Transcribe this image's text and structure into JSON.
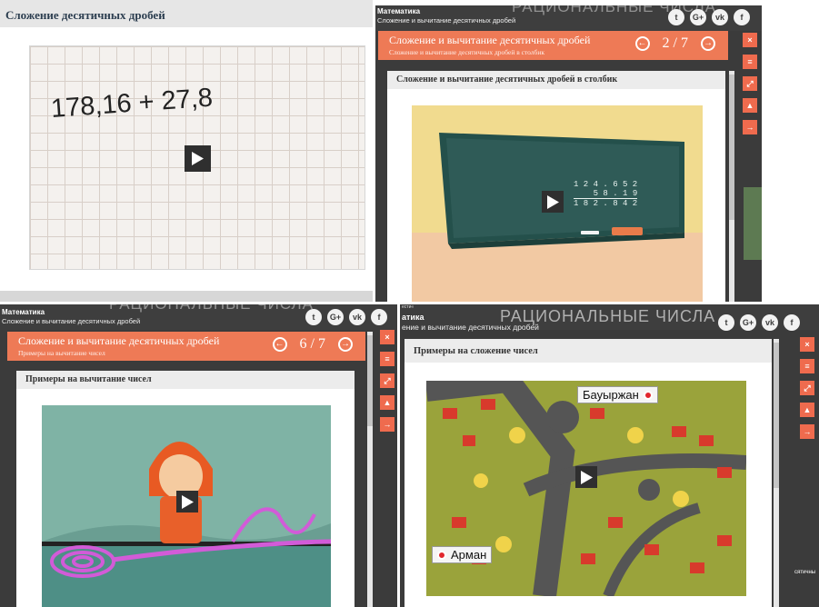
{
  "panel1": {
    "header": "Сложение десятичных дробей",
    "formula": "178,16 + 27,8"
  },
  "panel2": {
    "ghost_title": "РАЦИОНАЛЬНЫЕ ЧИСЛА",
    "subject": "Математика",
    "lesson": "Сложение и вычитание десятичных дробей",
    "orange_title": "Сложение и вычитание десятичных дробей",
    "orange_sub": "Сложение и вычитание десятичных дробей в столбик",
    "page": "2 / 7",
    "card_title": "Сложение и вычитание десятичных дробей в столбик",
    "board_row1": "1 2 4 . 6 5 2",
    "board_row2": "5 8 . 1 9",
    "board_row3": "1 8 2 . 8 4 2"
  },
  "panel3": {
    "ghost_title": "РАЦИОНАЛЬНЫЕ ЧИСЛА",
    "subject": "Математика",
    "lesson": "Сложение и вычитание десятичных дробей",
    "orange_title": "Сложение и вычитание десятичных дробей",
    "orange_sub": "Примеры на вычитание чисел",
    "page": "6 / 7",
    "card_title": "Примеры на вычитание чисел"
  },
  "panel4": {
    "ghost_title": "РАЦИОНАЛЬНЫЕ ЧИСЛА",
    "subject": "атика",
    "lesson": "ение и вычитание десятичных дробей",
    "tiny_label": "ести«",
    "card_title": "Примеры на сложение чисел",
    "label_a": "Бауыржан",
    "label_b": "Арман",
    "side_text": "сятичны"
  },
  "socials": [
    "t",
    "G+",
    "vk",
    "f"
  ],
  "side_buttons": [
    "×",
    "≡",
    "⤢",
    "▲",
    "→"
  ],
  "colors": {
    "accent_orange": "#ee7a56",
    "side_button": "#ef6b4e",
    "topbar": "#3e3e3e",
    "chalkboard": "#2f5b57"
  }
}
